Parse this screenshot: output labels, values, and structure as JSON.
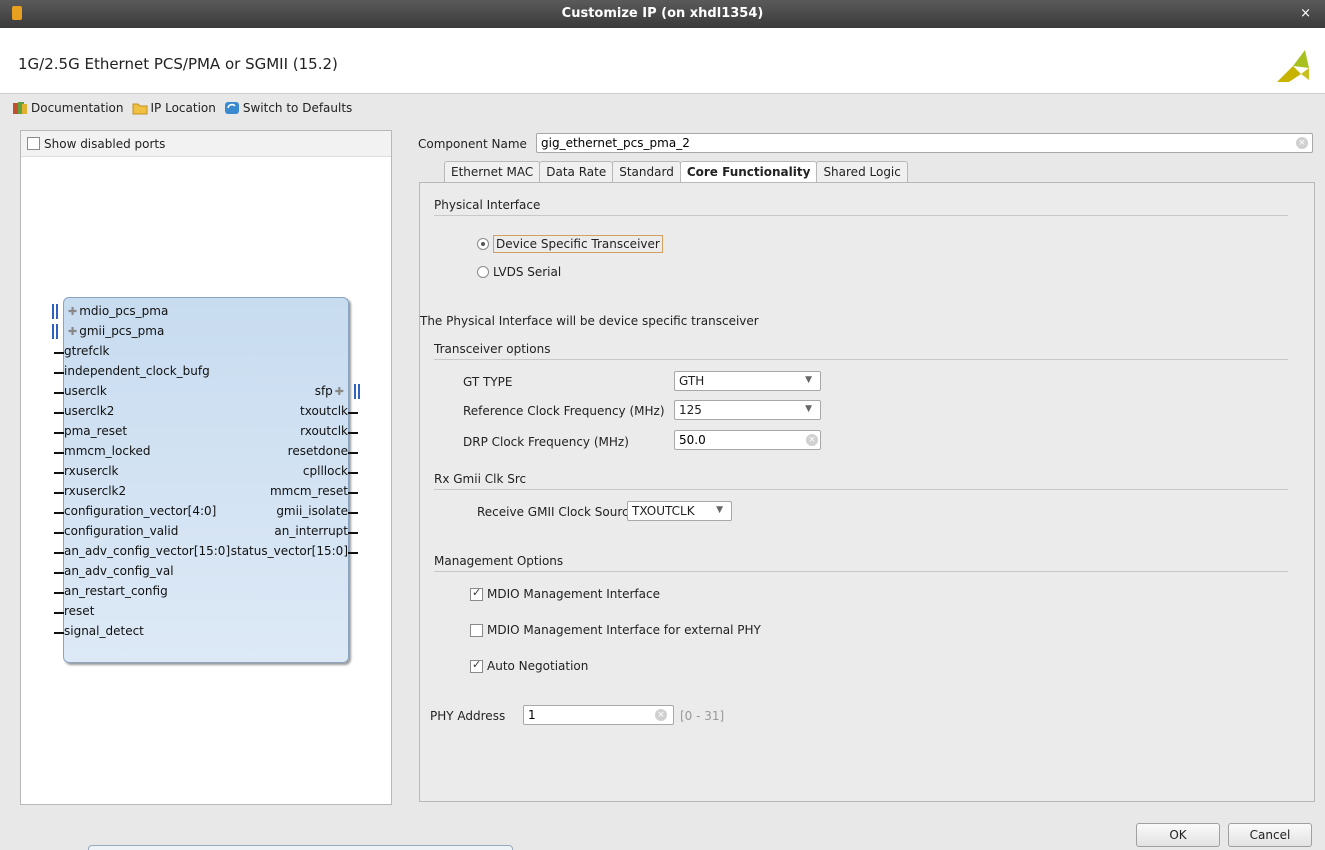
{
  "window": {
    "title": "Customize IP (on xhdl1354)",
    "close": "×"
  },
  "header": {
    "ip_title": "1G/2.5G Ethernet PCS/PMA or SGMII (15.2)"
  },
  "toolbar": {
    "documentation": "Documentation",
    "ip_location": "IP Location",
    "switch_defaults": "Switch to Defaults"
  },
  "left_panel": {
    "show_disabled_ports": "Show disabled ports",
    "left_pins": [
      {
        "label": "mdio_pcs_pma",
        "bus": true
      },
      {
        "label": "gmii_pcs_pma",
        "bus": true
      },
      {
        "label": "gtrefclk",
        "bus": false
      },
      {
        "label": "independent_clock_bufg",
        "bus": false
      },
      {
        "label": "userclk",
        "bus": false
      },
      {
        "label": "userclk2",
        "bus": false
      },
      {
        "label": "pma_reset",
        "bus": false
      },
      {
        "label": "mmcm_locked",
        "bus": false
      },
      {
        "label": "rxuserclk",
        "bus": false
      },
      {
        "label": "rxuserclk2",
        "bus": false
      },
      {
        "label": "configuration_vector[4:0]",
        "bus": false
      },
      {
        "label": "configuration_valid",
        "bus": false
      },
      {
        "label": "an_adv_config_vector[15:0]",
        "bus": false
      },
      {
        "label": "an_adv_config_val",
        "bus": false
      },
      {
        "label": "an_restart_config",
        "bus": false
      },
      {
        "label": "reset",
        "bus": false
      },
      {
        "label": "signal_detect",
        "bus": false
      }
    ],
    "right_pins": [
      {
        "label": "sfp",
        "bus": true,
        "row": 4
      },
      {
        "label": "txoutclk",
        "bus": false,
        "row": 5
      },
      {
        "label": "rxoutclk",
        "bus": false,
        "row": 6
      },
      {
        "label": "resetdone",
        "bus": false,
        "row": 7
      },
      {
        "label": "cplllock",
        "bus": false,
        "row": 8
      },
      {
        "label": "mmcm_reset",
        "bus": false,
        "row": 9
      },
      {
        "label": "gmii_isolate",
        "bus": false,
        "row": 10
      },
      {
        "label": "an_interrupt",
        "bus": false,
        "row": 11
      },
      {
        "label": "status_vector[15:0]",
        "bus": false,
        "row": 12
      }
    ]
  },
  "component": {
    "label": "Component Name",
    "value": "gig_ethernet_pcs_pma_2"
  },
  "tabs": [
    {
      "label": "Ethernet MAC",
      "active": false
    },
    {
      "label": "Data Rate",
      "active": false
    },
    {
      "label": "Standard",
      "active": false
    },
    {
      "label": "Core Functionality",
      "active": true
    },
    {
      "label": "Shared Logic",
      "active": false
    }
  ],
  "physical_interface": {
    "heading": "Physical Interface",
    "option1": "Device Specific Transceiver",
    "option2": "LVDS Serial",
    "note": "The Physical Interface will be device specific transceiver"
  },
  "transceiver": {
    "heading": "Transceiver options",
    "gt_type_label": "GT TYPE",
    "gt_type_value": "GTH",
    "ref_clk_label": "Reference Clock Frequency (MHz)",
    "ref_clk_value": "125",
    "drp_clk_label": "DRP Clock Frequency (MHz)",
    "drp_clk_value": "50.0"
  },
  "rx_gmii": {
    "heading": "Rx Gmii Clk Src",
    "label": "Receive GMII Clock Source",
    "value": "TXOUTCLK"
  },
  "management": {
    "heading": "Management Options",
    "mdio": "MDIO Management Interface",
    "mdio_ext": "MDIO Management Interface for external PHY",
    "auto_neg": "Auto Negotiation"
  },
  "phy": {
    "label": "PHY Address",
    "value": "1",
    "range": "[0 - 31]"
  },
  "buttons": {
    "ok": "OK",
    "cancel": "Cancel"
  },
  "colors": {
    "block_fill": "#c8dcf0",
    "bus_pin": "#3060c0",
    "logo": "#c8b400"
  }
}
